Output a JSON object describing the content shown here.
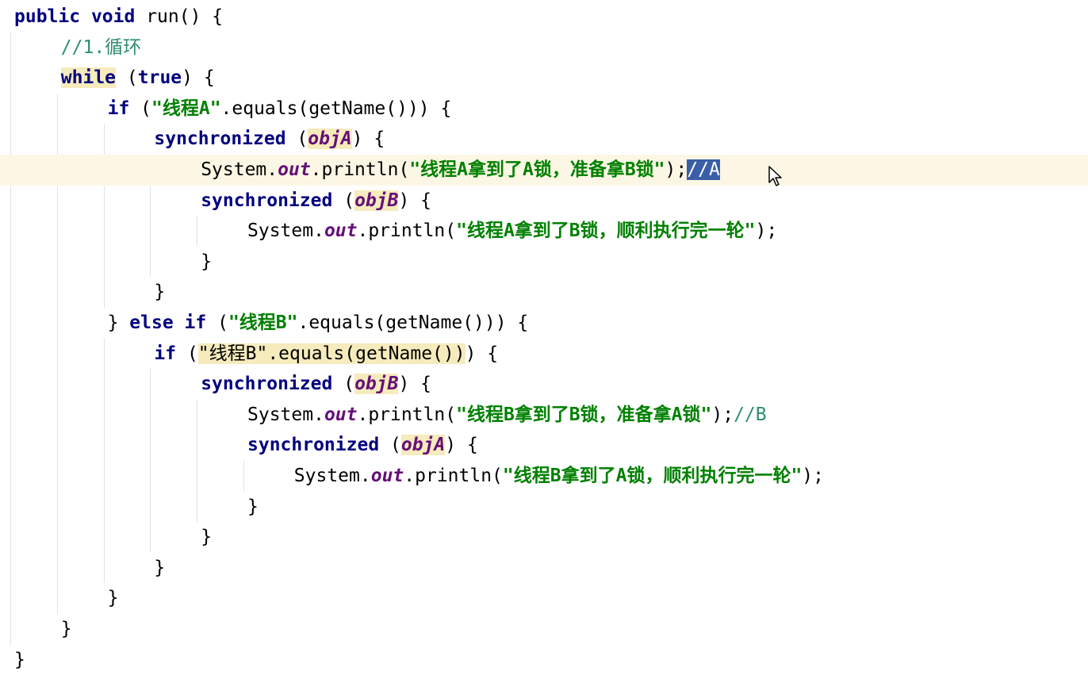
{
  "code": {
    "lines": [
      {
        "tokens": [
          {
            "t": "public ",
            "c": "kw"
          },
          {
            "t": "void ",
            "c": "kw"
          },
          {
            "t": "run() {",
            "c": ""
          }
        ],
        "indent": 0
      },
      {
        "tokens": [
          {
            "t": "//1.循环",
            "c": "cmg"
          }
        ],
        "indent": 1
      },
      {
        "tokens": [
          {
            "t": "while",
            "c": "kw hl"
          },
          {
            "t": " (",
            "c": ""
          },
          {
            "t": "true",
            "c": "kw"
          },
          {
            "t": ") {",
            "c": ""
          }
        ],
        "indent": 1
      },
      {
        "tokens": [
          {
            "t": "if",
            "c": "kw"
          },
          {
            "t": " (",
            "c": ""
          },
          {
            "t": "\"线程A\"",
            "c": "str"
          },
          {
            "t": ".equals(getName())) {",
            "c": ""
          }
        ],
        "indent": 2
      },
      {
        "tokens": [
          {
            "t": "synchronized",
            "c": "kw"
          },
          {
            "t": " (",
            "c": ""
          },
          {
            "t": "objA",
            "c": "fld hl"
          },
          {
            "t": ") {",
            "c": ""
          }
        ],
        "indent": 3
      },
      {
        "tokens": [
          {
            "t": "System.",
            "c": ""
          },
          {
            "t": "out",
            "c": "fld"
          },
          {
            "t": ".println(",
            "c": ""
          },
          {
            "t": "\"线程A拿到了A锁，准备拿B锁\"",
            "c": "str"
          },
          {
            "t": ");",
            "c": ""
          },
          {
            "t": "//A",
            "c": "sel"
          }
        ],
        "indent": 4,
        "current": true
      },
      {
        "tokens": [
          {
            "t": "synchronized",
            "c": "kw"
          },
          {
            "t": " (",
            "c": ""
          },
          {
            "t": "objB",
            "c": "fld hl"
          },
          {
            "t": ") {",
            "c": ""
          }
        ],
        "indent": 4
      },
      {
        "tokens": [
          {
            "t": "System.",
            "c": ""
          },
          {
            "t": "out",
            "c": "fld"
          },
          {
            "t": ".println(",
            "c": ""
          },
          {
            "t": "\"线程A拿到了B锁，顺利执行完一轮\"",
            "c": "str"
          },
          {
            "t": ");",
            "c": ""
          }
        ],
        "indent": 5
      },
      {
        "tokens": [
          {
            "t": "}",
            "c": ""
          }
        ],
        "indent": 4
      },
      {
        "tokens": [
          {
            "t": "}",
            "c": ""
          }
        ],
        "indent": 3
      },
      {
        "tokens": [
          {
            "t": "} ",
            "c": ""
          },
          {
            "t": "else if",
            "c": "kw"
          },
          {
            "t": " (",
            "c": ""
          },
          {
            "t": "\"线程B\"",
            "c": "str"
          },
          {
            "t": ".equals(getName())) {",
            "c": ""
          }
        ],
        "indent": 2
      },
      {
        "tokens": [
          {
            "t": "if",
            "c": "kw"
          },
          {
            "t": " (",
            "c": ""
          },
          {
            "t": "\"线程B\".equals(getName())",
            "c": "hlmix"
          },
          {
            "t": ") {",
            "c": ""
          }
        ],
        "indent": 3
      },
      {
        "tokens": [
          {
            "t": "synchronized",
            "c": "kw"
          },
          {
            "t": " (",
            "c": ""
          },
          {
            "t": "objB",
            "c": "fld hl"
          },
          {
            "t": ") {",
            "c": ""
          }
        ],
        "indent": 4
      },
      {
        "tokens": [
          {
            "t": "System.",
            "c": ""
          },
          {
            "t": "out",
            "c": "fld"
          },
          {
            "t": ".println(",
            "c": ""
          },
          {
            "t": "\"线程B拿到了B锁，准备拿A锁\"",
            "c": "str"
          },
          {
            "t": ");",
            "c": ""
          },
          {
            "t": "//B",
            "c": "cmg"
          }
        ],
        "indent": 5
      },
      {
        "tokens": [
          {
            "t": "synchronized",
            "c": "kw"
          },
          {
            "t": " (",
            "c": ""
          },
          {
            "t": "objA",
            "c": "fld hl"
          },
          {
            "t": ") {",
            "c": ""
          }
        ],
        "indent": 5
      },
      {
        "tokens": [
          {
            "t": "System.",
            "c": ""
          },
          {
            "t": "out",
            "c": "fld"
          },
          {
            "t": ".println(",
            "c": ""
          },
          {
            "t": "\"线程B拿到了A锁，顺利执行完一轮\"",
            "c": "str"
          },
          {
            "t": ");",
            "c": ""
          }
        ],
        "indent": 6
      },
      {
        "tokens": [
          {
            "t": "}",
            "c": ""
          }
        ],
        "indent": 5
      },
      {
        "tokens": [
          {
            "t": "}",
            "c": ""
          }
        ],
        "indent": 4
      },
      {
        "tokens": [
          {
            "t": "}",
            "c": ""
          }
        ],
        "indent": 3
      },
      {
        "tokens": [
          {
            "t": "}",
            "c": ""
          }
        ],
        "indent": 2
      },
      {
        "tokens": [
          {
            "t": "}",
            "c": ""
          }
        ],
        "indent": 1
      },
      {
        "tokens": [
          {
            "t": "}",
            "c": ""
          }
        ],
        "indent": 0
      }
    ]
  },
  "cursor": {
    "icon": "mouse-pointer-icon"
  },
  "colors": {
    "keyword": "#000080",
    "string": "#008000",
    "field": "#660e7a",
    "comment": "#2f8f6f",
    "selection": "#3a5fa8",
    "current_line": "#fcf7e5",
    "highlight": "#f6ebbc"
  }
}
